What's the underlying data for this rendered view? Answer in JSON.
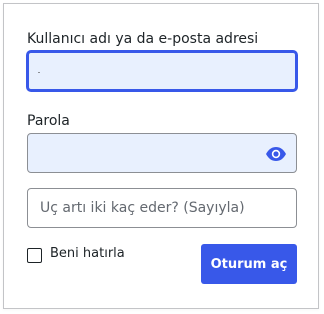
{
  "form": {
    "username_label": "Kullanıcı adı ya da e-posta adresi",
    "username_value": "",
    "password_label": "Parola",
    "password_value": "",
    "captcha_placeholder": "Üç artı iki kaç eder? (Sayıyla)",
    "remember_label": "Beni hatırla",
    "remember_checked": false,
    "submit_label": "Oturum aç"
  },
  "icons": {
    "password_toggle": "eye-icon"
  },
  "colors": {
    "accent": "#3858e9",
    "autofill_bg": "#e8f0fe",
    "border": "#8c8f94",
    "text": "#1d2327"
  }
}
